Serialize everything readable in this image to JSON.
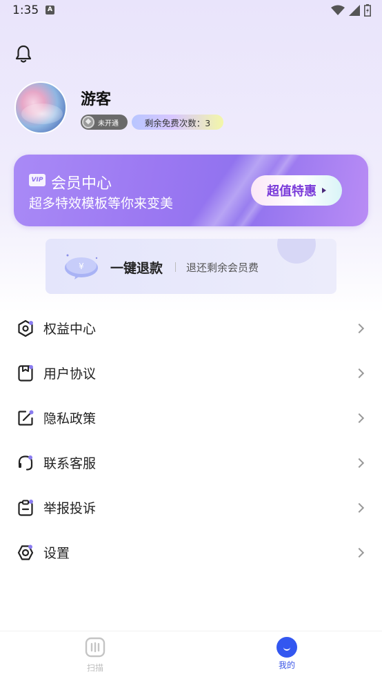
{
  "status_bar": {
    "time": "1:35",
    "notification_letter": "A"
  },
  "header": {
    "bell_icon": "bell-icon"
  },
  "profile": {
    "username": "游客",
    "member_status": "未开通",
    "free_count_label": "剩余免费次数：3"
  },
  "vip_card": {
    "badge": "VIP",
    "title": "会员中心",
    "subtitle": "超多特效模板等你来变美",
    "button_label": "超值特惠"
  },
  "refund": {
    "title": "一键退款",
    "subtitle": "退还剩余会员费"
  },
  "menu": {
    "items": [
      {
        "label": "权益中心",
        "icon": "hexagon-icon"
      },
      {
        "label": "用户协议",
        "icon": "document-icon"
      },
      {
        "label": "隐私政策",
        "icon": "edit-icon"
      },
      {
        "label": "联系客服",
        "icon": "headset-icon"
      },
      {
        "label": "举报投诉",
        "icon": "clipboard-icon"
      },
      {
        "label": "设置",
        "icon": "gear-icon"
      }
    ]
  },
  "bottom_nav": {
    "items": [
      {
        "label": "扫描",
        "active": false
      },
      {
        "label": "我的",
        "active": true
      }
    ]
  },
  "colors": {
    "accent": "#3357f0",
    "vip_purple": "#9b78f2",
    "icon_accent": "#8a7cf0"
  }
}
